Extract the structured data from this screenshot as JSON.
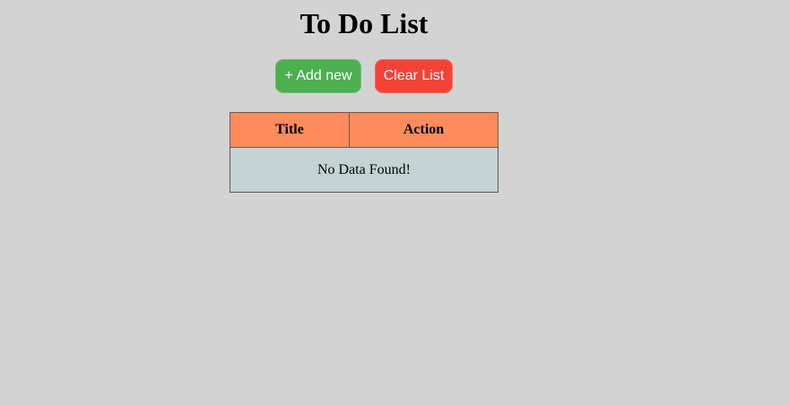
{
  "page": {
    "title": "To Do List"
  },
  "toolbar": {
    "add_label": "+ Add new",
    "clear_label": "Clear List"
  },
  "table": {
    "columns": [
      "Title",
      "Action"
    ],
    "empty_message": "No Data Found!"
  },
  "colors": {
    "background": "#d3d3d3",
    "add_button": "#4caf50",
    "clear_button": "#f44336",
    "table_header": "#ff8c5a",
    "table_body": "#c4d3d3"
  }
}
